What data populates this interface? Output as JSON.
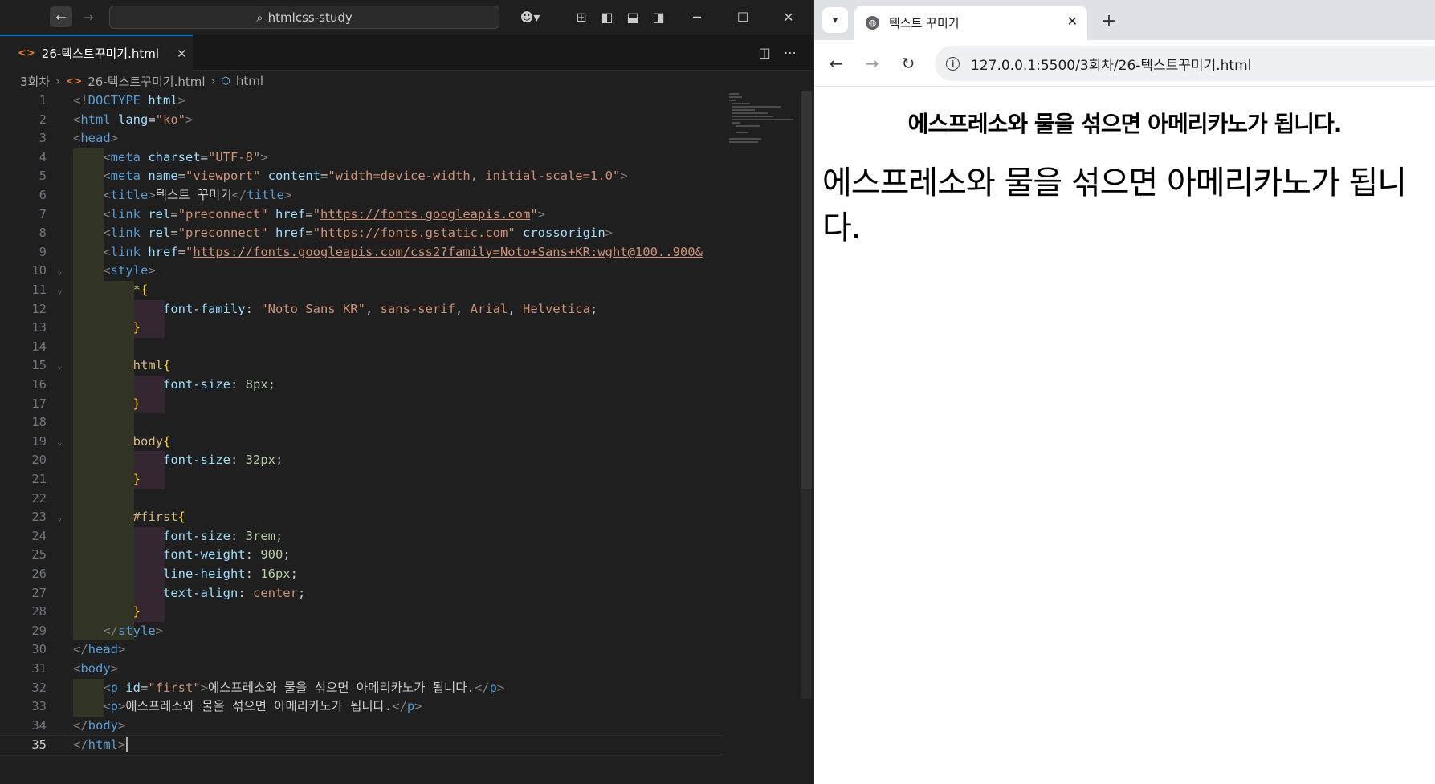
{
  "vscode": {
    "search_text": "htmlcss-study",
    "tab_label": "26-텍스트꾸미기.html",
    "breadcrumb": [
      "3회차",
      "26-텍스트꾸미기.html",
      "html"
    ],
    "lines": [
      {
        "n": "1",
        "parts": [
          [
            "br",
            "<!"
          ],
          [
            "tag",
            "DOCTYPE "
          ],
          [
            "attr",
            "html"
          ],
          [
            "br",
            ">"
          ]
        ]
      },
      {
        "n": "2",
        "parts": [
          [
            "br",
            "<"
          ],
          [
            "tag",
            "html "
          ],
          [
            "attr",
            "lang"
          ],
          [
            "pun",
            "="
          ],
          [
            "str",
            "\"ko\""
          ],
          [
            "br",
            ">"
          ]
        ]
      },
      {
        "n": "3",
        "parts": [
          [
            "br",
            "<"
          ],
          [
            "tag",
            "head"
          ],
          [
            "br",
            ">"
          ]
        ]
      },
      {
        "n": "4",
        "parts": [
          [
            "pun",
            "    "
          ],
          [
            "br",
            "<"
          ],
          [
            "tag",
            "meta "
          ],
          [
            "attr",
            "charset"
          ],
          [
            "pun",
            "="
          ],
          [
            "str",
            "\"UTF-8\""
          ],
          [
            "br",
            ">"
          ]
        ]
      },
      {
        "n": "5",
        "parts": [
          [
            "pun",
            "    "
          ],
          [
            "br",
            "<"
          ],
          [
            "tag",
            "meta "
          ],
          [
            "attr",
            "name"
          ],
          [
            "pun",
            "="
          ],
          [
            "str",
            "\"viewport\" "
          ],
          [
            "attr",
            "content"
          ],
          [
            "pun",
            "="
          ],
          [
            "str",
            "\"width=device-width, initial-scale=1.0\""
          ],
          [
            "br",
            ">"
          ]
        ]
      },
      {
        "n": "6",
        "parts": [
          [
            "pun",
            "    "
          ],
          [
            "br",
            "<"
          ],
          [
            "tag",
            "title"
          ],
          [
            "br",
            ">"
          ],
          [
            "text",
            "텍스트 꾸미기"
          ],
          [
            "br",
            "</"
          ],
          [
            "tag",
            "title"
          ],
          [
            "br",
            ">"
          ]
        ]
      },
      {
        "n": "7",
        "parts": [
          [
            "pun",
            "    "
          ],
          [
            "br",
            "<"
          ],
          [
            "tag",
            "link "
          ],
          [
            "attr",
            "rel"
          ],
          [
            "pun",
            "="
          ],
          [
            "str",
            "\"preconnect\" "
          ],
          [
            "attr",
            "href"
          ],
          [
            "pun",
            "="
          ],
          [
            "str",
            "\""
          ],
          [
            "url",
            "https://fonts.googleapis.com"
          ],
          [
            "str",
            "\""
          ],
          [
            "br",
            ">"
          ]
        ]
      },
      {
        "n": "8",
        "parts": [
          [
            "pun",
            "    "
          ],
          [
            "br",
            "<"
          ],
          [
            "tag",
            "link "
          ],
          [
            "attr",
            "rel"
          ],
          [
            "pun",
            "="
          ],
          [
            "str",
            "\"preconnect\" "
          ],
          [
            "attr",
            "href"
          ],
          [
            "pun",
            "="
          ],
          [
            "str",
            "\""
          ],
          [
            "url",
            "https://fonts.gstatic.com"
          ],
          [
            "str",
            "\" "
          ],
          [
            "attr",
            "crossorigin"
          ],
          [
            "br",
            ">"
          ]
        ]
      },
      {
        "n": "9",
        "parts": [
          [
            "pun",
            "    "
          ],
          [
            "br",
            "<"
          ],
          [
            "tag",
            "link "
          ],
          [
            "attr",
            "href"
          ],
          [
            "pun",
            "="
          ],
          [
            "str",
            "\""
          ],
          [
            "url",
            "https://fonts.googleapis.com/css2?family=Noto+Sans+KR:wght@100..900&"
          ]
        ]
      },
      {
        "n": "10",
        "parts": [
          [
            "pun",
            "    "
          ],
          [
            "br",
            "<"
          ],
          [
            "tag",
            "style"
          ],
          [
            "br",
            ">"
          ]
        ]
      },
      {
        "n": "11",
        "parts": [
          [
            "pun",
            "        "
          ],
          [
            "sel",
            "*"
          ],
          [
            "brace",
            "{"
          ]
        ]
      },
      {
        "n": "12",
        "parts": [
          [
            "pun",
            "            "
          ],
          [
            "prop",
            "font-family"
          ],
          [
            "pun",
            ": "
          ],
          [
            "val",
            "\"Noto Sans KR\""
          ],
          [
            "pun",
            ", "
          ],
          [
            "val",
            "sans-serif"
          ],
          [
            "pun",
            ", "
          ],
          [
            "val",
            "Arial"
          ],
          [
            "pun",
            ", "
          ],
          [
            "val",
            "Helvetica"
          ],
          [
            "pun",
            ";"
          ]
        ]
      },
      {
        "n": "13",
        "parts": [
          [
            "pun",
            "        "
          ],
          [
            "brace",
            "}"
          ]
        ]
      },
      {
        "n": "14",
        "parts": []
      },
      {
        "n": "15",
        "parts": [
          [
            "pun",
            "        "
          ],
          [
            "sel",
            "html"
          ],
          [
            "brace",
            "{"
          ]
        ]
      },
      {
        "n": "16",
        "parts": [
          [
            "pun",
            "            "
          ],
          [
            "prop",
            "font-size"
          ],
          [
            "pun",
            ": "
          ],
          [
            "num",
            "8px"
          ],
          [
            "pun",
            ";"
          ]
        ]
      },
      {
        "n": "17",
        "parts": [
          [
            "pun",
            "        "
          ],
          [
            "brace",
            "}"
          ]
        ]
      },
      {
        "n": "18",
        "parts": []
      },
      {
        "n": "19",
        "parts": [
          [
            "pun",
            "        "
          ],
          [
            "sel",
            "body"
          ],
          [
            "brace",
            "{"
          ]
        ]
      },
      {
        "n": "20",
        "parts": [
          [
            "pun",
            "            "
          ],
          [
            "prop",
            "font-size"
          ],
          [
            "pun",
            ": "
          ],
          [
            "num",
            "32px"
          ],
          [
            "pun",
            ";"
          ]
        ]
      },
      {
        "n": "21",
        "parts": [
          [
            "pun",
            "        "
          ],
          [
            "brace",
            "}"
          ]
        ]
      },
      {
        "n": "22",
        "parts": []
      },
      {
        "n": "23",
        "parts": [
          [
            "pun",
            "        "
          ],
          [
            "sel",
            "#first"
          ],
          [
            "brace",
            "{"
          ]
        ]
      },
      {
        "n": "24",
        "parts": [
          [
            "pun",
            "            "
          ],
          [
            "prop",
            "font-size"
          ],
          [
            "pun",
            ": "
          ],
          [
            "num",
            "3rem"
          ],
          [
            "pun",
            ";"
          ]
        ]
      },
      {
        "n": "25",
        "parts": [
          [
            "pun",
            "            "
          ],
          [
            "prop",
            "font-weight"
          ],
          [
            "pun",
            ": "
          ],
          [
            "num",
            "900"
          ],
          [
            "pun",
            ";"
          ]
        ]
      },
      {
        "n": "26",
        "parts": [
          [
            "pun",
            "            "
          ],
          [
            "prop",
            "line-height"
          ],
          [
            "pun",
            ": "
          ],
          [
            "num",
            "16px"
          ],
          [
            "pun",
            ";"
          ]
        ]
      },
      {
        "n": "27",
        "parts": [
          [
            "pun",
            "            "
          ],
          [
            "prop",
            "text-align"
          ],
          [
            "pun",
            ": "
          ],
          [
            "val",
            "center"
          ],
          [
            "pun",
            ";"
          ]
        ]
      },
      {
        "n": "28",
        "parts": [
          [
            "pun",
            "        "
          ],
          [
            "brace",
            "}"
          ]
        ]
      },
      {
        "n": "29",
        "parts": [
          [
            "pun",
            "    "
          ],
          [
            "br",
            "</"
          ],
          [
            "tag",
            "style"
          ],
          [
            "br",
            ">"
          ]
        ]
      },
      {
        "n": "30",
        "parts": [
          [
            "br",
            "</"
          ],
          [
            "tag",
            "head"
          ],
          [
            "br",
            ">"
          ]
        ]
      },
      {
        "n": "31",
        "parts": [
          [
            "br",
            "<"
          ],
          [
            "tag",
            "body"
          ],
          [
            "br",
            ">"
          ]
        ]
      },
      {
        "n": "32",
        "parts": [
          [
            "pun",
            "    "
          ],
          [
            "br",
            "<"
          ],
          [
            "tag",
            "p "
          ],
          [
            "attr",
            "id"
          ],
          [
            "pun",
            "="
          ],
          [
            "str",
            "\"first\""
          ],
          [
            "br",
            ">"
          ],
          [
            "text",
            "에스프레소와 물을 섞으면 아메리카노가 됩니다."
          ],
          [
            "br",
            "</"
          ],
          [
            "tag",
            "p"
          ],
          [
            "br",
            ">"
          ]
        ]
      },
      {
        "n": "33",
        "parts": [
          [
            "pun",
            "    "
          ],
          [
            "br",
            "<"
          ],
          [
            "tag",
            "p"
          ],
          [
            "br",
            ">"
          ],
          [
            "text",
            "에스프레소와 물을 섞으면 아메리카노가 됩니다."
          ],
          [
            "br",
            "</"
          ],
          [
            "tag",
            "p"
          ],
          [
            "br",
            ">"
          ]
        ]
      },
      {
        "n": "34",
        "parts": [
          [
            "br",
            "</"
          ],
          [
            "tag",
            "body"
          ],
          [
            "br",
            ">"
          ]
        ]
      },
      {
        "n": "35",
        "parts": [
          [
            "br",
            "</"
          ],
          [
            "tag",
            "html"
          ],
          [
            "br",
            ">"
          ]
        ]
      }
    ]
  },
  "browser": {
    "tab_title": "텍스트 꾸미기",
    "url": "127.0.0.1:5500/3회차/26-텍스트꾸미기.html",
    "heading": "에스프레소와 물을 섞으면 아메리카노가 됩니다.",
    "paragraph": "에스프레소와 물을 섞으면 아메리카노가 됩니다."
  }
}
